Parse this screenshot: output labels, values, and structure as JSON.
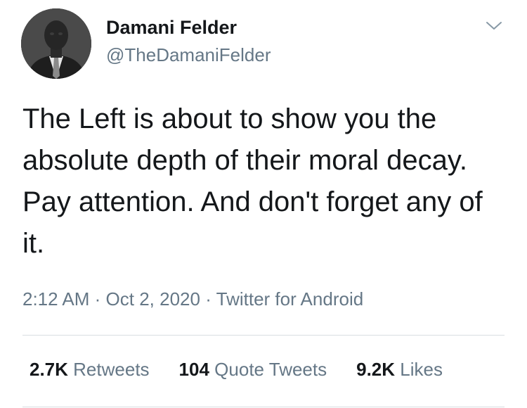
{
  "tweet": {
    "author": {
      "display_name": "Damani Felder",
      "handle": "@TheDamaniFelder"
    },
    "text": "The Left is about to show you the absolute depth of their moral decay. Pay attention. And don't forget any of it.",
    "timestamp": "2:12 AM",
    "separator": "·",
    "date": "Oct 2, 2020",
    "source": "Twitter for Android",
    "stats": {
      "retweets": {
        "count": "2.7K",
        "label": "Retweets"
      },
      "quote_tweets": {
        "count": "104",
        "label": "Quote Tweets"
      },
      "likes": {
        "count": "9.2K",
        "label": "Likes"
      }
    }
  },
  "icons": {
    "menu": "chevron-down-icon",
    "avatar": "avatar"
  },
  "colors": {
    "text_primary": "#14171a",
    "text_secondary": "#657786",
    "divider": "#d8dde1"
  }
}
